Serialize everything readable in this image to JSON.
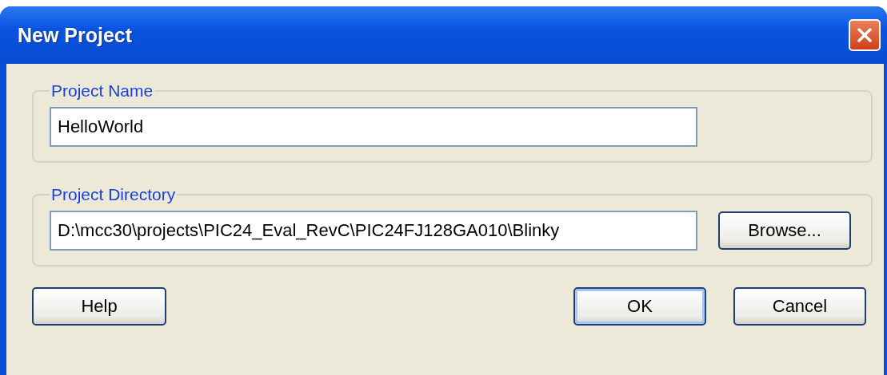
{
  "window": {
    "title": "New Project"
  },
  "groups": [
    {
      "legend": "Project Name",
      "field": {
        "value": "HelloWorld"
      }
    },
    {
      "legend": "Project Directory",
      "field": {
        "value": "D:\\mcc30\\projects\\PIC24_Eval_RevC\\PIC24FJ128GA010\\Blinky"
      },
      "button": {
        "label": "Browse...",
        "default": false
      }
    }
  ],
  "buttons": [
    {
      "label": "Help",
      "default": false
    },
    {
      "label": "OK",
      "default": true
    },
    {
      "label": "Cancel",
      "default": false
    }
  ]
}
